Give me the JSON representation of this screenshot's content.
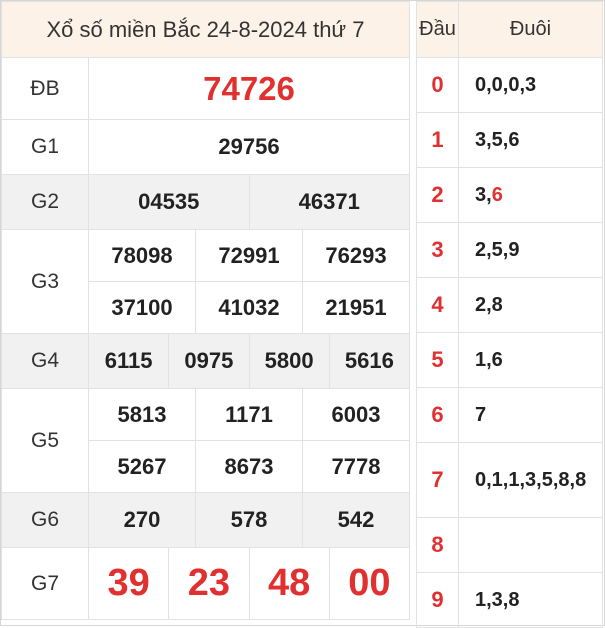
{
  "title": "Xổ số miền Bắc 24-8-2024 thứ 7",
  "prizes": {
    "db": {
      "label": "ĐB",
      "values": [
        "74726"
      ]
    },
    "g1": {
      "label": "G1",
      "values": [
        "29756"
      ]
    },
    "g2": {
      "label": "G2",
      "values": [
        "04535",
        "46371"
      ]
    },
    "g3": {
      "label": "G3",
      "values": [
        "78098",
        "72991",
        "76293",
        "37100",
        "41032",
        "21951"
      ]
    },
    "g4": {
      "label": "G4",
      "values": [
        "6115",
        "0975",
        "5800",
        "5616"
      ]
    },
    "g5": {
      "label": "G5",
      "values": [
        "5813",
        "1171",
        "6003",
        "5267",
        "8673",
        "7778"
      ]
    },
    "g6": {
      "label": "G6",
      "values": [
        "270",
        "578",
        "542"
      ]
    },
    "g7": {
      "label": "G7",
      "values": [
        "39",
        "23",
        "48",
        "00"
      ]
    }
  },
  "dau_duoi": {
    "dau_header": "Đầu",
    "duoi_header": "Đuôi",
    "rows": [
      {
        "dau": "0",
        "duoi": "0,0,0,3"
      },
      {
        "dau": "1",
        "duoi": "3,5,6"
      },
      {
        "dau": "2",
        "duoi_prefix": "3,",
        "duoi_highlight": "6"
      },
      {
        "dau": "3",
        "duoi": "2,5,9"
      },
      {
        "dau": "4",
        "duoi": "2,8"
      },
      {
        "dau": "5",
        "duoi": "1,6"
      },
      {
        "dau": "6",
        "duoi": "7"
      },
      {
        "dau": "7",
        "duoi": "0,1,1,3,5,8,8"
      },
      {
        "dau": "8",
        "duoi": ""
      },
      {
        "dau": "9",
        "duoi": "1,3,8"
      }
    ]
  },
  "colors": {
    "accent_red": "#e03030",
    "header_bg": "#fdf2e7",
    "row_gray": "#f1f1f1"
  }
}
